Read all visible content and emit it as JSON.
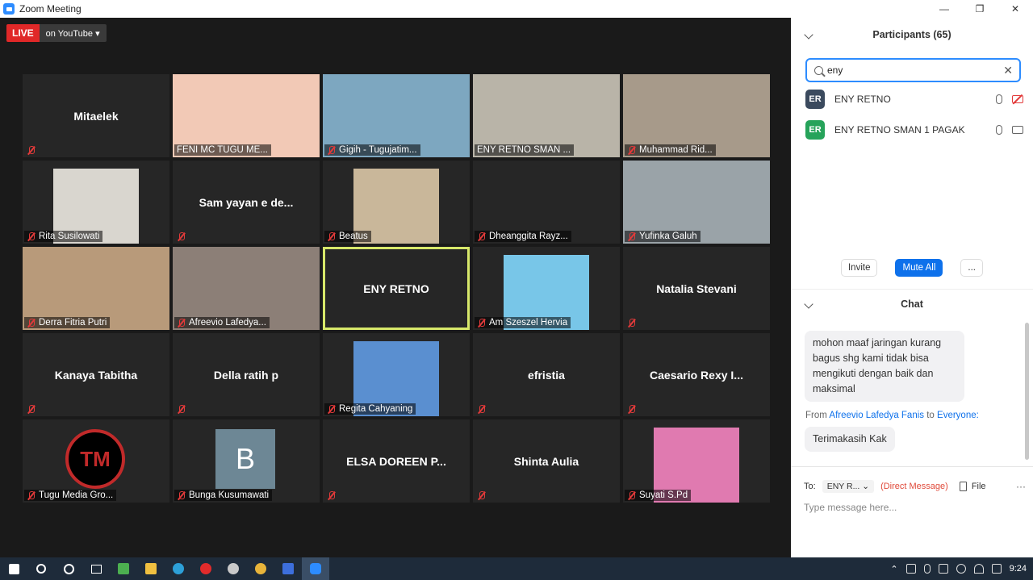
{
  "window": {
    "title": "Zoom Meeting",
    "minimize": "—",
    "restore": "❐",
    "close": "✕"
  },
  "live": {
    "badge": "LIVE",
    "platform": "on YouTube",
    "caret": "▾"
  },
  "tiles": [
    {
      "name": "Mitaelek",
      "center": true,
      "muted": true
    },
    {
      "name": "FENI MC TUGU ME...",
      "center": false,
      "muted": false,
      "photo": "#f2c9b6"
    },
    {
      "name": "Gigih - Tugujatim...",
      "center": false,
      "muted": true,
      "photo": "#7da7c0"
    },
    {
      "name": "ENY RETNO SMAN ...",
      "center": false,
      "muted": false,
      "photo": "#b9b4a8"
    },
    {
      "name": "Muhammad Rid...",
      "center": false,
      "muted": true,
      "photo": "#a79a8a"
    },
    {
      "name": "Rita Susilowati",
      "center": false,
      "muted": true,
      "photo": "#d9d6cf",
      "photo_small": true
    },
    {
      "name": "Sam yayan e de...",
      "center": true,
      "muted": true
    },
    {
      "name": "Beatus",
      "center": false,
      "muted": true,
      "photo": "#c9b79a",
      "photo_small": true
    },
    {
      "name": "Dheanggita Rayz...",
      "center": false,
      "muted": true
    },
    {
      "name": "Yufinka  Galuh",
      "center": false,
      "muted": true,
      "photo": "#9aa3a8"
    },
    {
      "name": "Derra Fitria Putri",
      "center": false,
      "muted": true,
      "photo": "#b89a7a"
    },
    {
      "name": "Afreevio Lafedya...",
      "center": false,
      "muted": true,
      "photo": "#8c7f77"
    },
    {
      "name": "ENY RETNO",
      "center": true,
      "muted": false,
      "active": true
    },
    {
      "name": "Am Szeszel Hervia",
      "center": false,
      "muted": true,
      "photo": "#78c6e8",
      "photo_small": true
    },
    {
      "name": "Natalia Stevani",
      "center": true,
      "muted": true
    },
    {
      "name": "Kanaya Tabitha",
      "center": true,
      "muted": true
    },
    {
      "name": "Della ratih p",
      "center": true,
      "muted": true
    },
    {
      "name": "Regita Cahyaning",
      "center": false,
      "muted": true,
      "photo": "#5a8fd0",
      "photo_small": true
    },
    {
      "name": "efristia",
      "center": true,
      "muted": true
    },
    {
      "name": "Caesario  Rexy I...",
      "center": true,
      "muted": true
    },
    {
      "name": "Tugu Media Gro...",
      "center": false,
      "muted": true,
      "logo": "TM"
    },
    {
      "name": "Bunga Kusumawati",
      "center": false,
      "muted": true,
      "letter": "B"
    },
    {
      "name": "ELSA  DOREEN  P...",
      "center": true,
      "muted": true
    },
    {
      "name": "Shinta Aulia",
      "center": true,
      "muted": true
    },
    {
      "name": "Suyati S.Pd",
      "center": false,
      "muted": true,
      "photo": "#e07ab0",
      "photo_small": true
    }
  ],
  "participants": {
    "title": "Participants (65)",
    "search_value": "eny",
    "clear": "✕",
    "list": [
      {
        "initials": "ER",
        "name": "ENY RETNO",
        "color": "#3b4a5e",
        "video_off": true
      },
      {
        "initials": "ER",
        "name": "ENY RETNO SMAN 1 PAGAK",
        "color": "#26a35a",
        "video_off": false
      }
    ],
    "invite": "Invite",
    "mute_all": "Mute All",
    "more": "..."
  },
  "chat": {
    "title": "Chat",
    "message1": "mohon maaf jaringan kurang bagus shg kami tidak bisa mengikuti dengan baik dan maksimal",
    "from_prefix": "From",
    "from_name": "Afreevio Lafedya Fanis",
    "from_to": "to",
    "from_target": "Everyone:",
    "message2": "Terimakasih Kak",
    "to_label": "To:",
    "to_value": "ENY R...",
    "to_caret": "⌄",
    "direct": "(Direct Message)",
    "file": "File",
    "more": "···",
    "placeholder": "Type message here..."
  },
  "taskbar": {
    "clock": "9:24"
  }
}
